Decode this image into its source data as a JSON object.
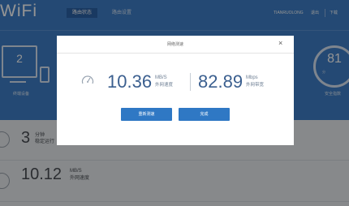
{
  "header": {
    "logo": "WiFi",
    "nav_tabs": [
      {
        "label": "路由状态",
        "active": true
      },
      {
        "label": "路由设置",
        "active": false
      }
    ],
    "user": {
      "name": "TIANRUOLONG",
      "logout": "退出",
      "download": "下载"
    }
  },
  "devices": {
    "count": "2",
    "label": "终端设备"
  },
  "gauge": {
    "value": "81",
    "label": "分",
    "sublabel": "安全指数"
  },
  "stats": [
    {
      "value": "3",
      "line1": "分钟",
      "line2": "稳定运行"
    },
    {
      "value": "10.12",
      "line1": "MB/S",
      "line2": "外网速度"
    }
  ],
  "modal": {
    "title": "网络测速",
    "close": "×",
    "download": {
      "value": "10.36",
      "unit": "MB/S",
      "label": "外网速度"
    },
    "bandwidth": {
      "value": "82.89",
      "unit": "Mbps",
      "label": "外网带宽"
    },
    "retest_button": "重新测速",
    "done_button": "完成"
  },
  "colors": {
    "accent": "#3f7fc8",
    "button": "#2f78c4",
    "speed_text": "#3b5f8f"
  }
}
